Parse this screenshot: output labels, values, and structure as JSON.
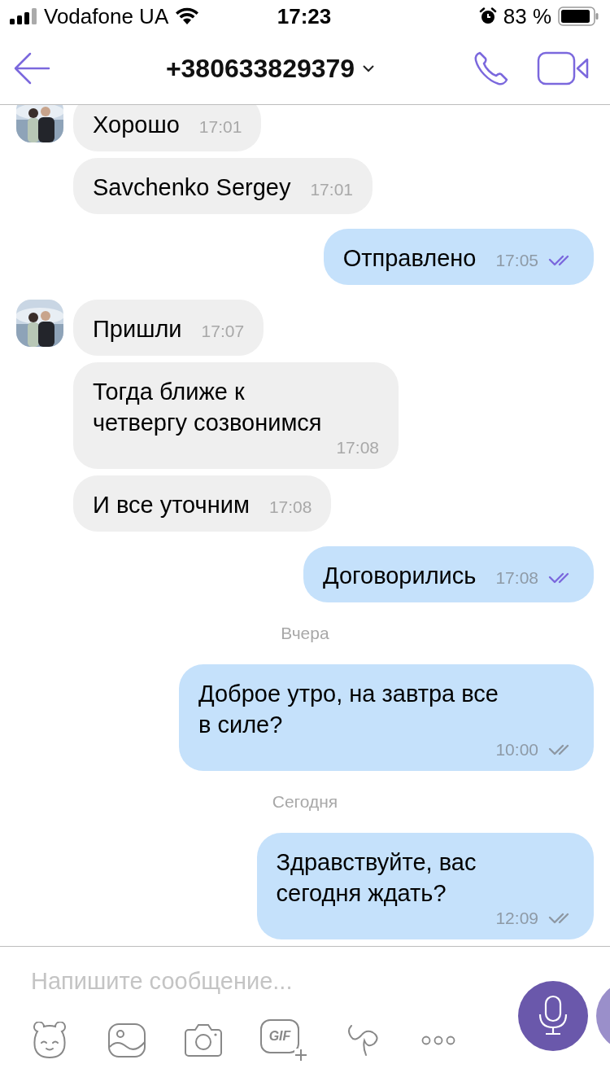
{
  "status_bar": {
    "carrier": "Vodafone UA",
    "time": "17:23",
    "battery": "83 %"
  },
  "header": {
    "title": "+380633829379"
  },
  "messages": [
    {
      "kind": "in",
      "text": "Хорошо",
      "time": "17:01",
      "avatar": true
    },
    {
      "kind": "in",
      "text": "Savchenko Sergey",
      "time": "17:01",
      "avatar": false
    },
    {
      "kind": "out",
      "text": "Отправлено",
      "time": "17:05",
      "read": true
    },
    {
      "kind": "in",
      "text": "Пришли",
      "time": "17:07",
      "avatar": true
    },
    {
      "kind": "in",
      "text": "Тогда ближе к\nчетвергу созвонимся",
      "time": "17:08",
      "avatar": false
    },
    {
      "kind": "in",
      "text": "И все уточним",
      "time": "17:08",
      "avatar": false
    },
    {
      "kind": "out",
      "text": "Договорились",
      "time": "17:08",
      "read": true
    },
    {
      "kind": "date",
      "text": "Вчера"
    },
    {
      "kind": "out",
      "text": "Доброе утро, на завтра все\nв силе?",
      "time": "10:00",
      "read": false
    },
    {
      "kind": "date",
      "text": "Сегодня"
    },
    {
      "kind": "out",
      "text": "Здравствуйте, вас\nсегодня ждать?",
      "time": "12:09",
      "read": false
    }
  ],
  "composer": {
    "placeholder": "Напишите сообщение..."
  },
  "toolbar": [
    {
      "kind": "sticker"
    },
    {
      "kind": "gallery"
    },
    {
      "kind": "camera"
    },
    {
      "kind": "gif",
      "label": "GIF"
    },
    {
      "kind": "doodle"
    },
    {
      "kind": "more"
    }
  ]
}
